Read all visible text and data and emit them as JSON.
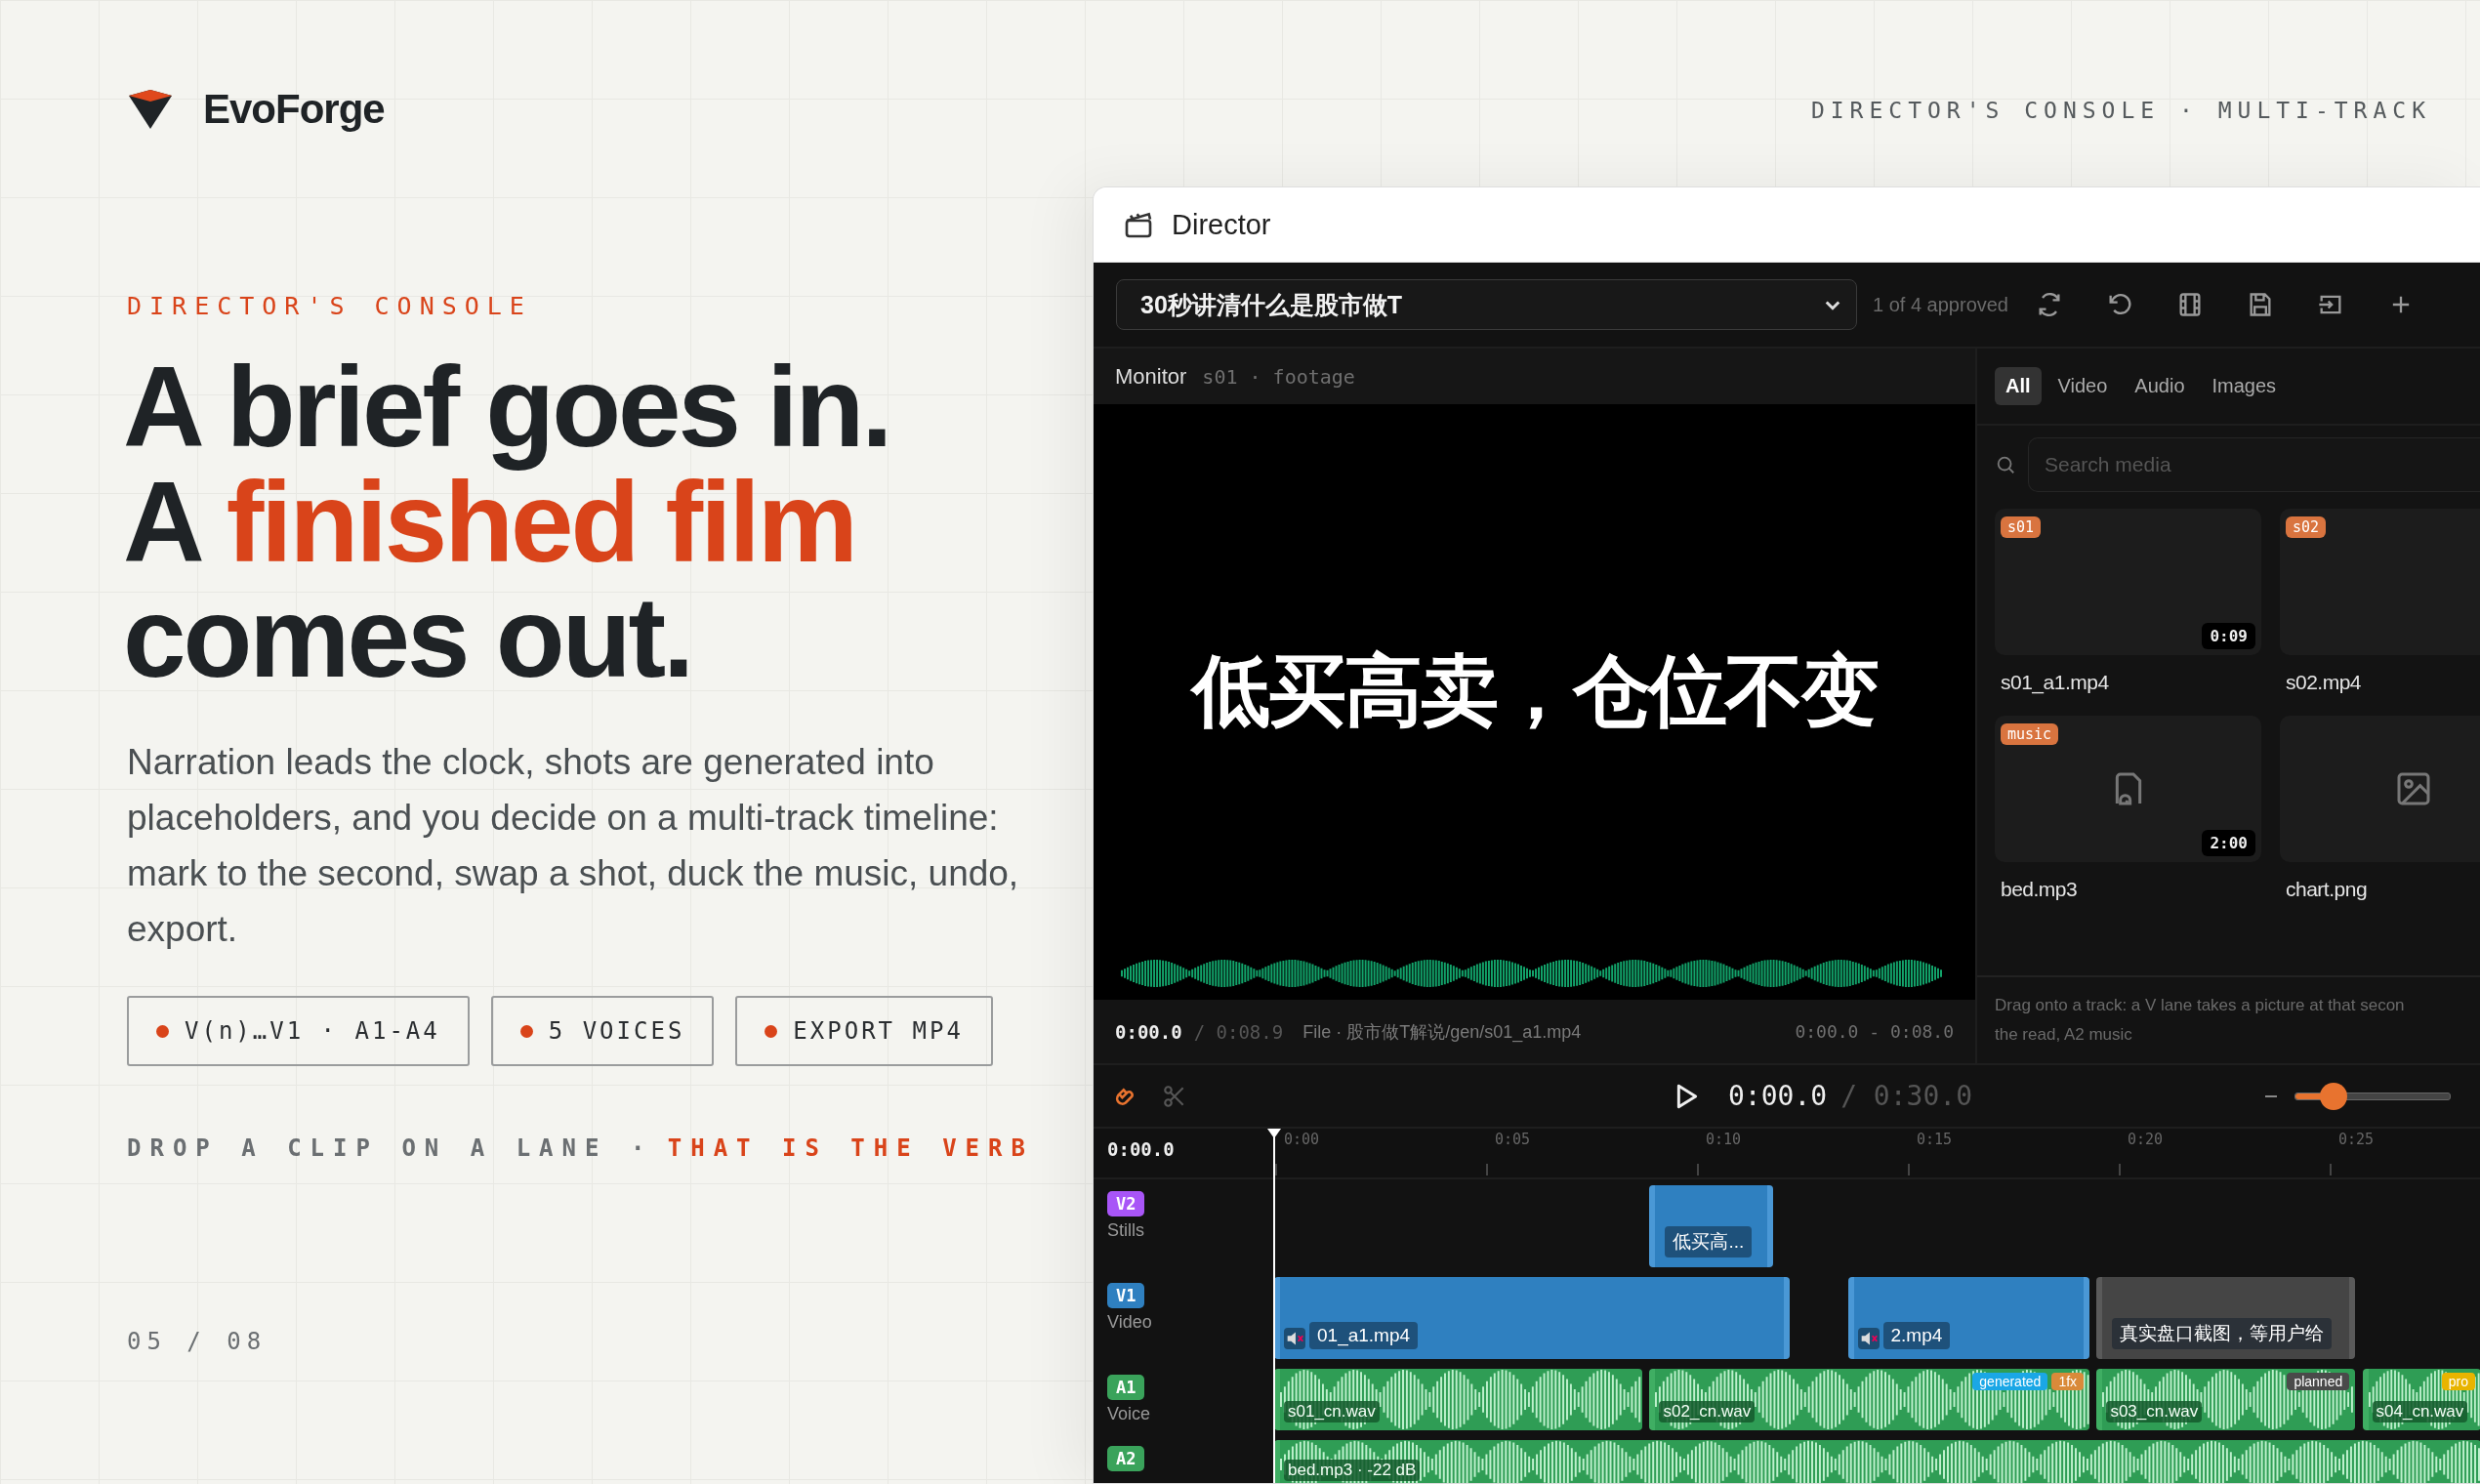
{
  "brand": {
    "name": "EvoForge"
  },
  "top_label": "DIRECTOR'S CONSOLE · MULTI-TRACK",
  "hero": {
    "kicker": "DIRECTOR'S CONSOLE",
    "headline": [
      [
        {
          "text": "A brief goes in.",
          "accent": false
        }
      ],
      [
        {
          "text": "A ",
          "accent": false
        },
        {
          "text": "finished film",
          "accent": true
        }
      ],
      [
        {
          "text": "comes out.",
          "accent": false
        }
      ]
    ],
    "paragraph": "Narration leads the clock, shots are generated into placeholders, and you decide on a multi-track timeline: mark to the second, swap a shot, duck the music, undo, export.",
    "chips": [
      "V(n)…V1 · A1-A4",
      "5 VOICES",
      "EXPORT MP4"
    ],
    "drop_line": [
      {
        "text": "DROP A CLIP ON A LANE ·",
        "accent": false
      },
      {
        "text": "THAT IS THE VERB",
        "accent": true
      }
    ],
    "page_indicator": "05 / 08"
  },
  "director": {
    "title": "Director",
    "project": "30秒讲清什么是股市做T",
    "approval": "1 of 4 approved",
    "monitor": {
      "label": "Monitor",
      "source": "s01 · footage",
      "subtitle": "低买高卖，仓位不变",
      "time": "0:00.0",
      "duration": "/ 0:08.9",
      "file": "File · 股市做T解说/gen/s01_a1.mp4",
      "range": "0:00.0 - 0:08.0"
    },
    "media": {
      "tabs": [
        {
          "label": "All",
          "selected": true
        },
        {
          "label": "Video",
          "selected": false
        },
        {
          "label": "Audio",
          "selected": false
        },
        {
          "label": "Images",
          "selected": false
        }
      ],
      "search": {
        "placeholder": "Search media"
      },
      "items": [
        {
          "kind": "video",
          "name": "s01_a1.mp4",
          "badge": "s01",
          "duration": "0:09"
        },
        {
          "kind": "video",
          "name": "s02.mp4",
          "badge": "s02"
        },
        {
          "kind": "audio",
          "name": "bed.mp3",
          "badge": "music",
          "duration": "2:00"
        },
        {
          "kind": "image",
          "name": "chart.png"
        }
      ],
      "hint": [
        "Drag onto a track: a V lane takes a picture at that secon",
        "the read, A2 music"
      ]
    },
    "transport": {
      "snap": true,
      "time": "0:00.0",
      "total": "/ 0:30.0",
      "zoom": {
        "level": 0.25
      }
    },
    "timeline": {
      "time": "0:00.0",
      "ticks": [
        "0:00",
        "0:05",
        "0:10",
        "0:15",
        "0:20",
        "0:25"
      ],
      "tracks": [
        {
          "badge": "V2",
          "label": "Stills",
          "color": "#a855f7",
          "clips": [
            {
              "kind": "still",
              "label": "低买高..."
            }
          ]
        },
        {
          "badge": "V1",
          "label": "Video",
          "color": "#2f80c0",
          "clips": [
            {
              "kind": "video",
              "label": "01_a1.mp4"
            },
            {
              "kind": "video",
              "label": "2.mp4"
            },
            {
              "kind": "placeholder",
              "label": "真实盘口截图，等用户给"
            }
          ]
        },
        {
          "badge": "A1",
          "label": "Voice",
          "color": "#3aa35b",
          "clips": [
            {
              "kind": "audio",
              "label": "s01_cn.wav"
            },
            {
              "kind": "audio",
              "label": "s02_cn.wav",
              "tags": [
                {
                  "text": "generated",
                  "color": "#1aa7e6"
                },
                {
                  "text": "1fx",
                  "color": "#d98a3a"
                }
              ]
            },
            {
              "kind": "audio",
              "label": "s03_cn.wav",
              "tags": [
                {
                  "text": "planned",
                  "color": "#4a4a4a"
                }
              ]
            },
            {
              "kind": "audio",
              "label": "s04_cn.wav",
              "tags": [
                {
                  "text": "pro",
                  "color": "#e8b400"
                }
              ]
            }
          ]
        },
        {
          "badge": "A2",
          "color": "#3aa35b",
          "clips": [
            {
              "kind": "audio",
              "label": "bed.mp3 · -22 dB"
            }
          ]
        }
      ]
    }
  }
}
